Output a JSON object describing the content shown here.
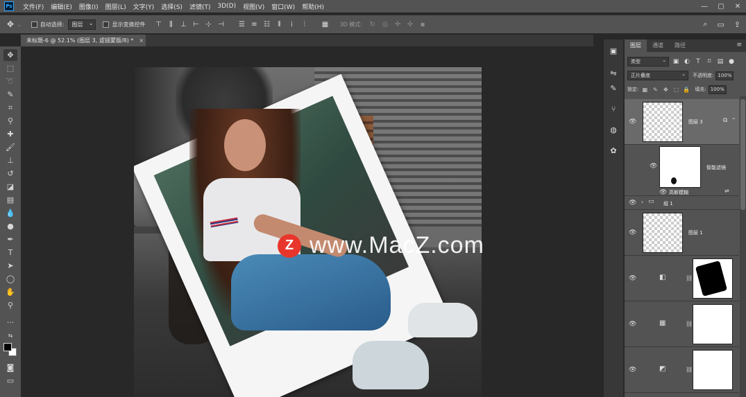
{
  "menu": {
    "logo": "Ps",
    "items": [
      "文件(F)",
      "编辑(E)",
      "图像(I)",
      "图层(L)",
      "文字(Y)",
      "选择(S)",
      "滤镜(T)",
      "3D(D)",
      "视图(V)",
      "窗口(W)",
      "帮助(H)"
    ],
    "window_controls": [
      "—",
      "▢",
      "✕"
    ]
  },
  "options": {
    "auto_select_label": "自动选择:",
    "auto_select_value": "图层",
    "show_transform_label": "显示变换控件",
    "mode_label": "3D 模式:"
  },
  "document": {
    "tab_title": "未标题-6 @ 52.1% (图层 3, 滤镜蒙版/8) *",
    "close": "×"
  },
  "watermark": {
    "logo_letter": "Z",
    "text": "www.MacZ.com"
  },
  "layers_panel": {
    "tabs": [
      "图层",
      "通道",
      "路径"
    ],
    "filter_kind": "类型",
    "blend_mode": "正片叠底",
    "opacity_label": "不透明度:",
    "opacity_value": "100%",
    "lock_label": "锁定:",
    "fill_label": "填充:",
    "fill_value": "100%",
    "layers": {
      "layer3": "图层 3",
      "smart_filter": "智能滤镜",
      "gaussian_blur": "高斯模糊",
      "group1": "组 1",
      "layer1": "图层 1"
    }
  },
  "colors": {
    "ui_dark": "#282828",
    "ui_panel": "#535353",
    "watermark_red": "#e8362c"
  }
}
